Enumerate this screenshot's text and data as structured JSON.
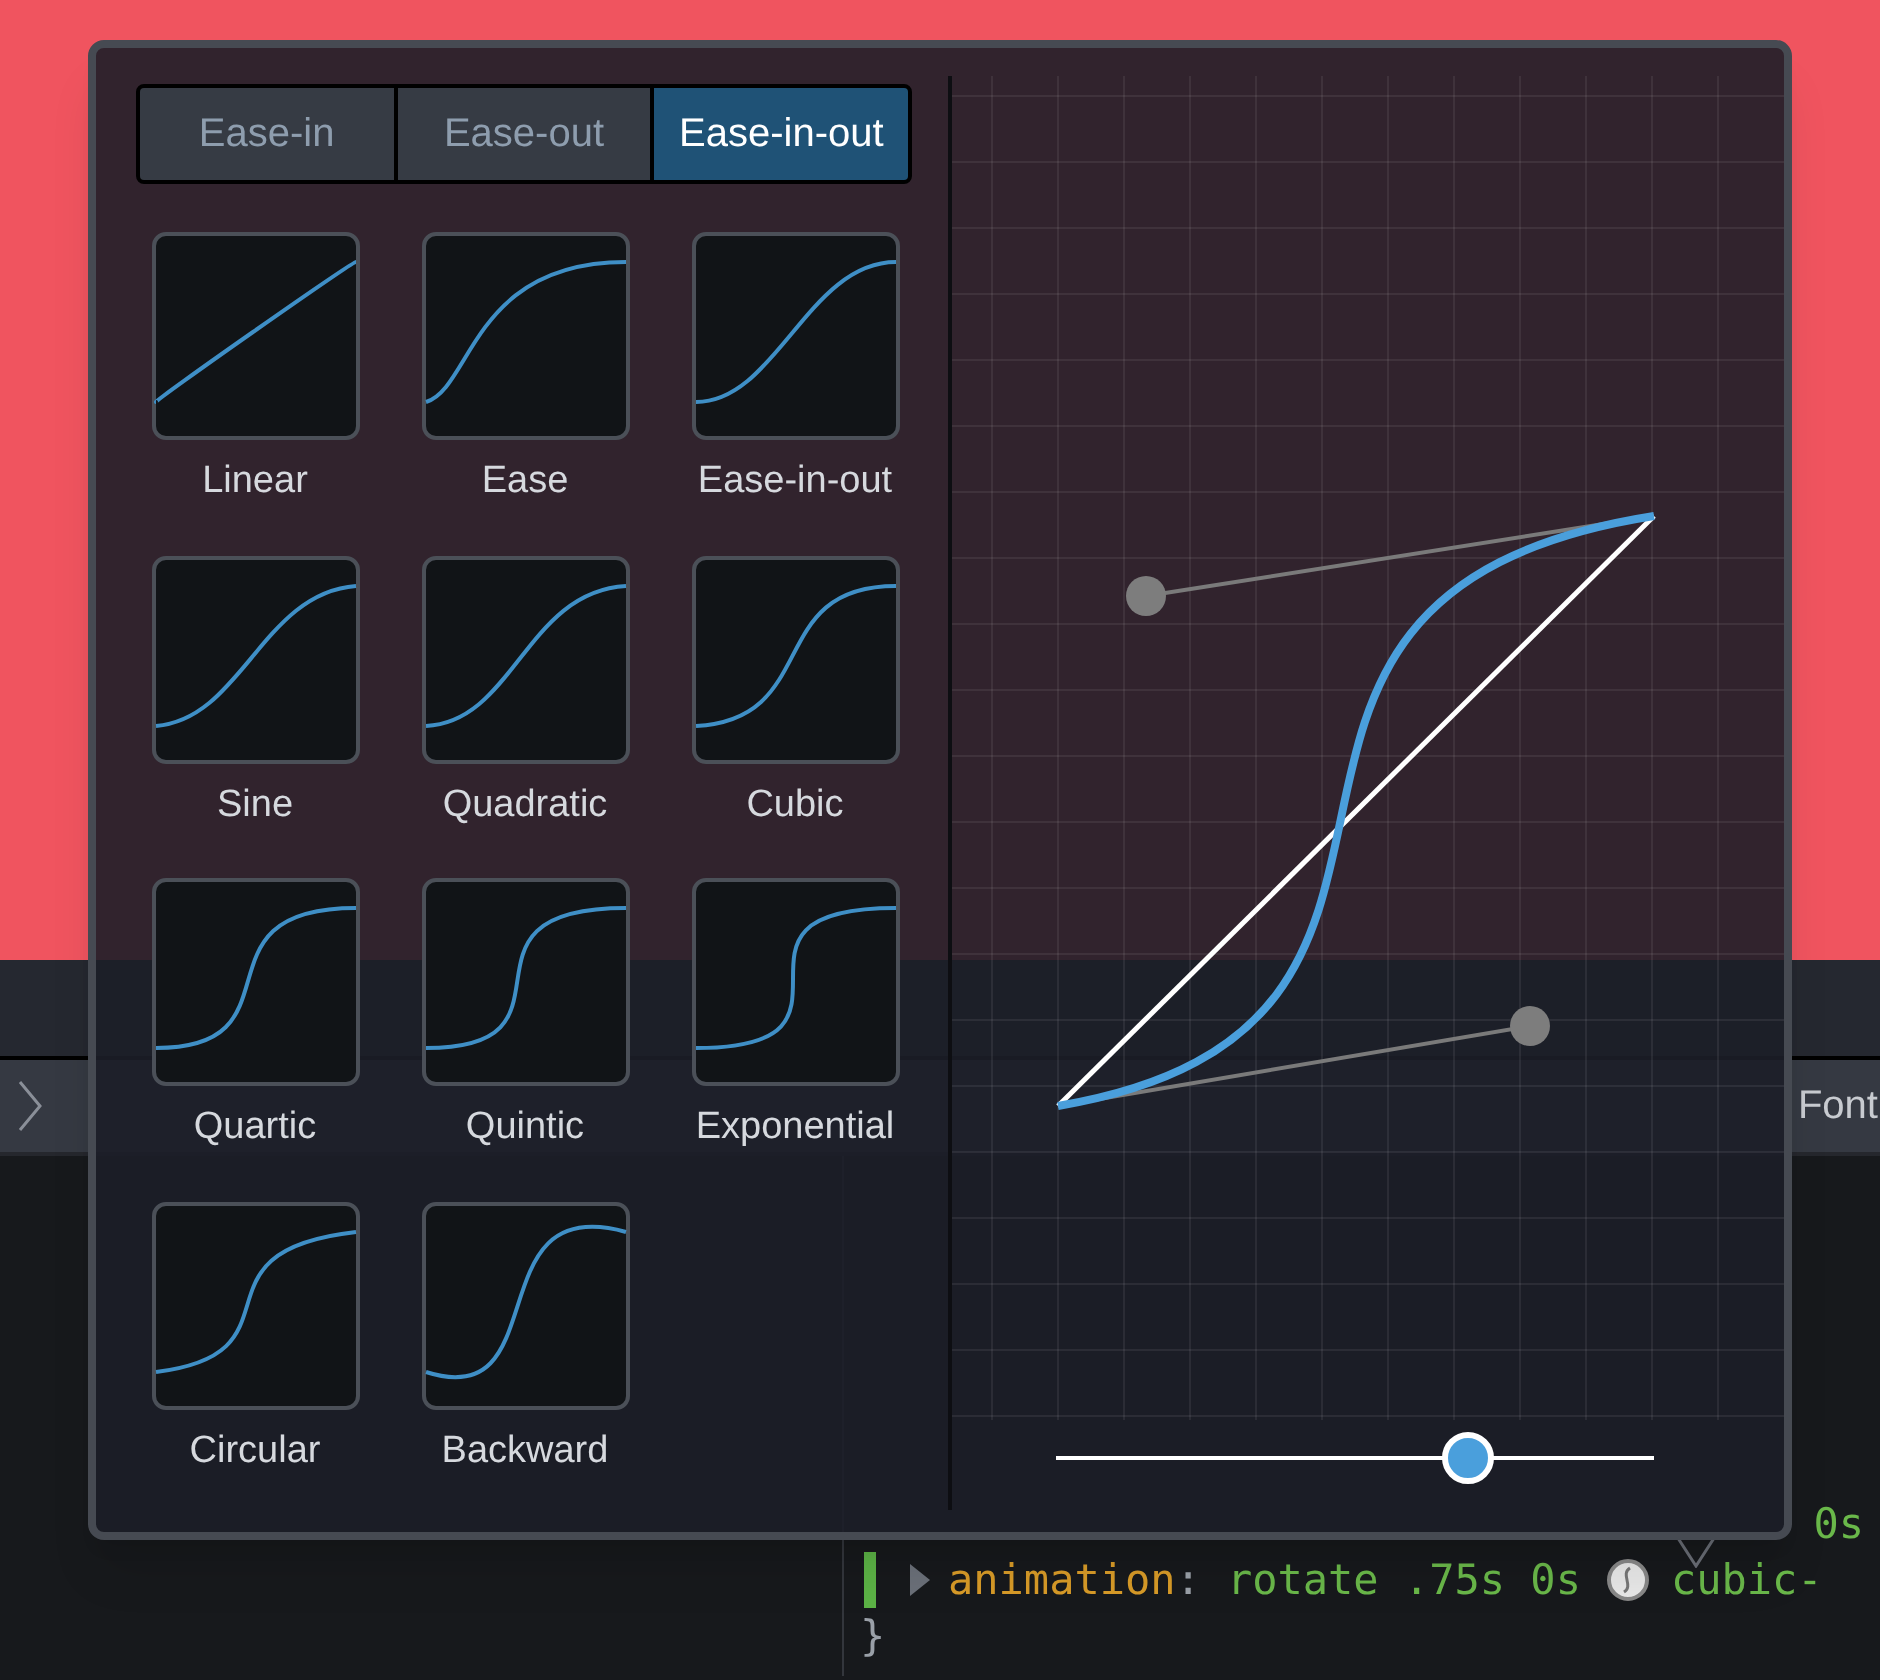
{
  "tabs": [
    {
      "label": "Ease-in",
      "selected": false
    },
    {
      "label": "Ease-out",
      "selected": false
    },
    {
      "label": "Ease-in-out",
      "selected": true
    }
  ],
  "presets": [
    {
      "label": "Linear",
      "kind": "linear"
    },
    {
      "label": "Ease",
      "kind": "ease"
    },
    {
      "label": "Ease-in-out",
      "kind": "easeinout"
    },
    {
      "label": "Sine",
      "kind": "sine"
    },
    {
      "label": "Quadratic",
      "kind": "quad"
    },
    {
      "label": "Cubic",
      "kind": "cubic"
    },
    {
      "label": "Quartic",
      "kind": "quart"
    },
    {
      "label": "Quintic",
      "kind": "quint"
    },
    {
      "label": "Exponential",
      "kind": "expo"
    },
    {
      "label": "Circular",
      "kind": "circ"
    },
    {
      "label": "Backward",
      "kind": "back"
    }
  ],
  "editor": {
    "slider": {
      "level": 0.69
    }
  },
  "sidebar_tab": "Font",
  "rules": {
    "partial_line_tail": "0s",
    "property": "animation",
    "separator": ":",
    "value": "rotate .75s 0s",
    "value_tail": "cubic-",
    "closing_brace": "}"
  }
}
